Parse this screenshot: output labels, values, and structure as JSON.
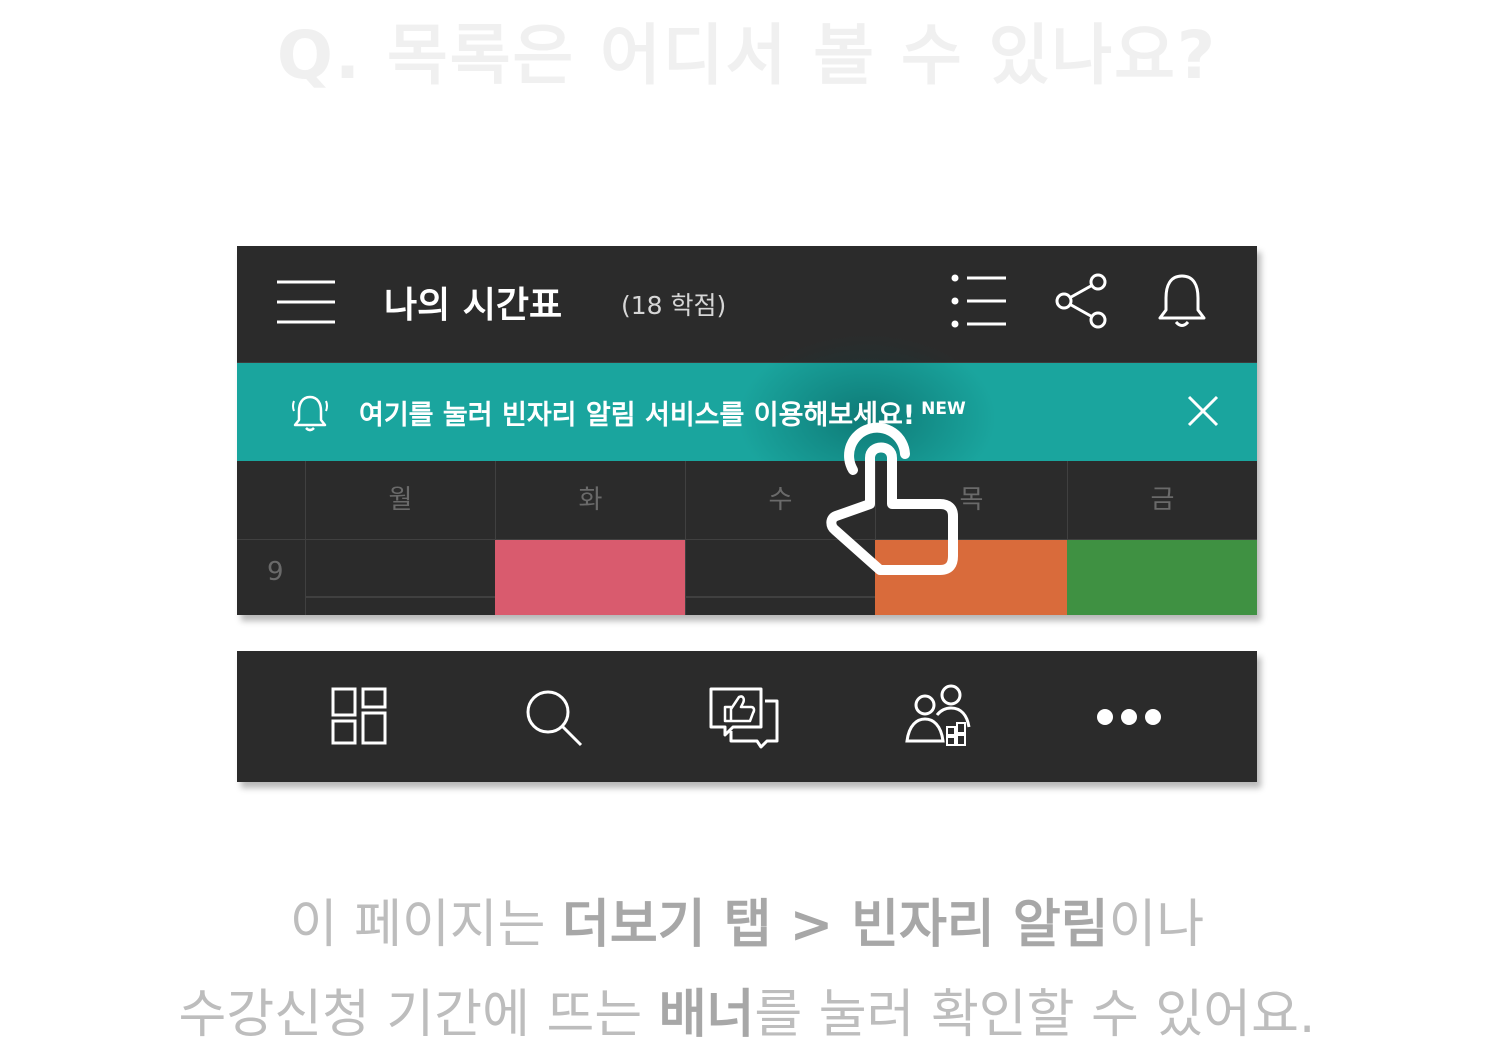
{
  "question": "Q. 목록은 어디서 볼 수 있나요?",
  "header": {
    "title": "나의 시간표",
    "credits": "(18 학점)",
    "icons": [
      "menu-icon",
      "list-icon",
      "share-icon",
      "bell-icon"
    ]
  },
  "banner": {
    "text": "여기를 눌러 빈자리 알림 서비스를 이용해보세요!",
    "badge": "NEW",
    "icons": [
      "bell-icon",
      "close-icon"
    ],
    "color": "#1aa59e"
  },
  "timetable": {
    "days": [
      "월",
      "화",
      "수",
      "목",
      "금"
    ],
    "time": "9",
    "class_colors": [
      "#d95b6e",
      "#d96b3b",
      "#3f9142"
    ]
  },
  "bottom_nav": {
    "icons": [
      "timetable-icon",
      "search-icon",
      "community-icon",
      "friends-icon",
      "more-icon"
    ]
  },
  "caption": {
    "line1_part1": "이 페이지는 ",
    "line1_bold1": "더보기 탭 > 빈자리 알림",
    "line1_part2": "이나",
    "line2_part1": "수강신청 기간에 뜨는 ",
    "line2_bold1": "배너",
    "line2_part2": "를 눌러 확인할 수 있어요."
  }
}
